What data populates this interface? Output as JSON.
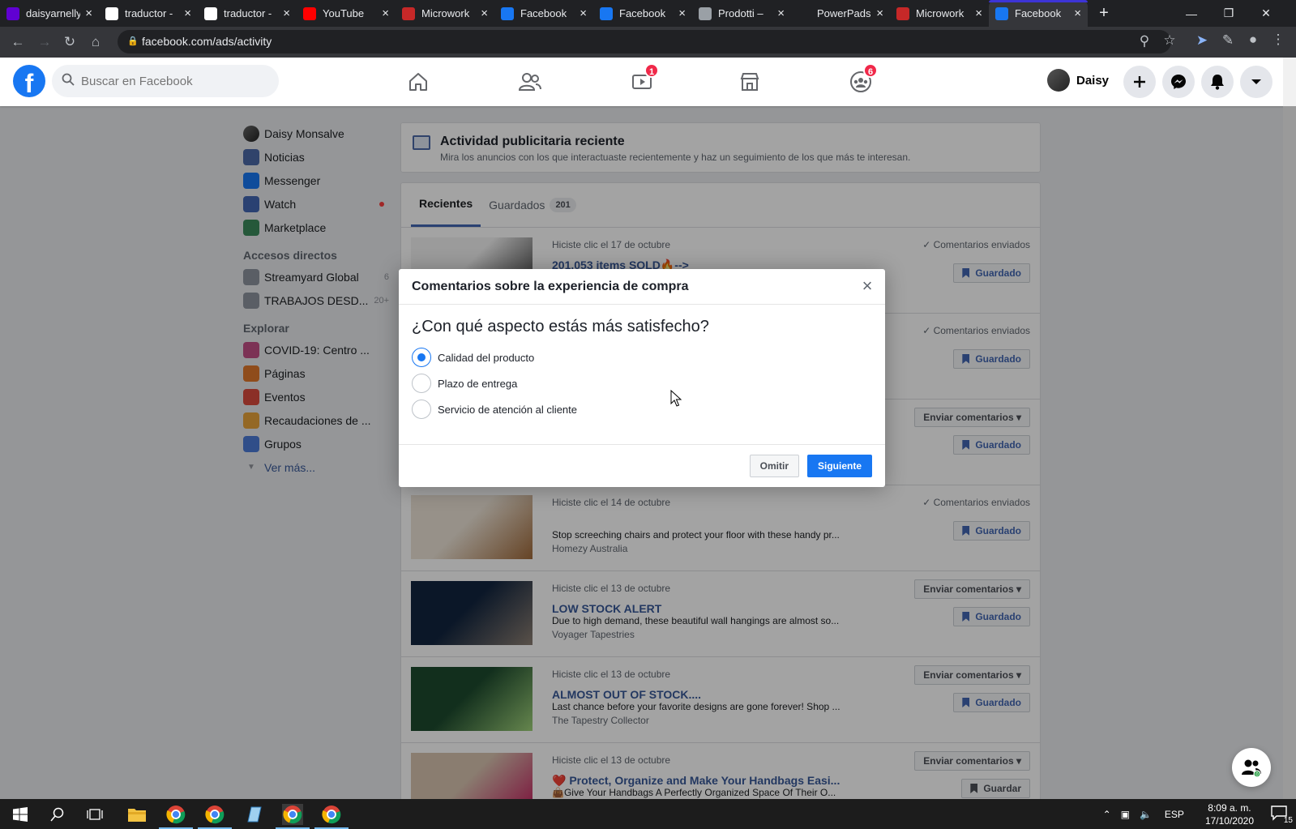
{
  "browser": {
    "tabs": [
      {
        "title": "daisyarnelly",
        "favicon": "mail-icon",
        "color": "#6001d2"
      },
      {
        "title": "traductor -",
        "favicon": "google-icon",
        "color": "#ffffff"
      },
      {
        "title": "traductor -",
        "favicon": "google-icon",
        "color": "#ffffff"
      },
      {
        "title": "YouTube",
        "favicon": "youtube-icon",
        "color": "#ff0000"
      },
      {
        "title": "Microwork",
        "favicon": "microworkers-icon",
        "color": "#c62828"
      },
      {
        "title": "Facebook",
        "favicon": "facebook-icon",
        "color": "#1877f2"
      },
      {
        "title": "Facebook",
        "favicon": "facebook-icon",
        "color": "#1877f2"
      },
      {
        "title": "Prodotti –",
        "favicon": "globe-icon",
        "color": "#9aa0a6"
      },
      {
        "title": "PowerPads",
        "favicon": "blank-icon",
        "color": "#202124"
      },
      {
        "title": "Microwork",
        "favicon": "microworkers-icon",
        "color": "#c62828"
      },
      {
        "title": "Facebook",
        "favicon": "facebook-icon",
        "color": "#1877f2",
        "active": true
      }
    ],
    "url": "facebook.com/ads/activity"
  },
  "header": {
    "logo": "f",
    "search_placeholder": "Buscar en Facebook",
    "watch_badge": "1",
    "groups_badge": "6",
    "user_name": "Daisy"
  },
  "sidebar": {
    "user": "Daisy Monsalve",
    "items": [
      {
        "label": "Noticias",
        "color": "#4b6aa8"
      },
      {
        "label": "Messenger",
        "color": "#1877f2"
      },
      {
        "label": "Watch",
        "color": "#4267b2"
      },
      {
        "label": "Marketplace",
        "color": "#3a8a5c"
      }
    ],
    "shortcuts_heading": "Accesos directos",
    "shortcuts": [
      {
        "label": "Streamyard Global",
        "count": "6"
      },
      {
        "label": "TRABAJOS DESD...",
        "count": "20+"
      }
    ],
    "explore_heading": "Explorar",
    "explore": [
      {
        "label": "COVID-19: Centro ...",
        "color": "#c34f86"
      },
      {
        "label": "Páginas",
        "color": "#e0782b"
      },
      {
        "label": "Eventos",
        "color": "#d94a3d"
      },
      {
        "label": "Recaudaciones de ...",
        "color": "#e8a33b"
      },
      {
        "label": "Grupos",
        "color": "#4b7bd6"
      }
    ],
    "more": "Ver más..."
  },
  "activity": {
    "title": "Actividad publicitaria reciente",
    "subtitle": "Mira los anuncios con los que interactuaste recientemente y haz un seguimiento de los que más te interesan.",
    "tab_recent": "Recientes",
    "tab_saved": "Guardados",
    "saved_count": "201",
    "ads": [
      {
        "date": "Hiciste clic el 17 de octubre",
        "title": "201.053 items SOLD🔥-->",
        "desc": "",
        "advertiser": "",
        "status": "✓ Comentarios enviados",
        "feedback": "",
        "save": "Guardado",
        "thumb_a": "#f2f2f2",
        "thumb_b": "#2a2a2a"
      },
      {
        "date": "",
        "title": "",
        "desc": "",
        "advertiser": "",
        "status": "✓ Comentarios enviados",
        "feedback": "",
        "save": "Guardado",
        "thumb_a": "#ffffff",
        "thumb_b": "#ffffff"
      },
      {
        "date": "",
        "title": "",
        "desc": "",
        "advertiser": "",
        "status": "",
        "feedback": "Enviar comentarios ▾",
        "save": "Guardado",
        "thumb_a": "#ffffff",
        "thumb_b": "#ffffff"
      },
      {
        "date": "Hiciste clic el 14 de octubre",
        "title": "",
        "desc": "Stop screeching chairs and protect your floor with these handy pr...",
        "advertiser": "Homezy Australia",
        "status": "✓ Comentarios enviados",
        "feedback": "",
        "save": "Guardado",
        "thumb_a": "#ece3d6",
        "thumb_b": "#a06a3a"
      },
      {
        "date": "Hiciste clic el 13 de octubre",
        "title": "LOW STOCK ALERT",
        "desc": "Due to high demand, these beautiful wall hangings are almost so...",
        "advertiser": "Voyager Tapestries",
        "status": "",
        "feedback": "Enviar comentarios ▾",
        "save": "Guardado",
        "thumb_a": "#12253f",
        "thumb_b": "#8c7f73"
      },
      {
        "date": "Hiciste clic el 13 de octubre",
        "title": "ALMOST OUT OF STOCK....",
        "desc": "Last chance before your favorite designs are gone forever! Shop ...",
        "advertiser": "The Tapestry Collector",
        "status": "",
        "feedback": "Enviar comentarios ▾",
        "save": "Guardado",
        "thumb_a": "#1d4a2e",
        "thumb_b": "#9fd27a"
      },
      {
        "date": "Hiciste clic el 13 de octubre",
        "title": "❤️ Protect, Organize and Make Your Handbags Easi...",
        "desc": "👜Give Your Handbags A Perfectly Organized Space Of Their O...",
        "advertiser": "",
        "status": "",
        "feedback": "Enviar comentarios ▾",
        "save": "Guardar",
        "thumb_a": "#d8c4b0",
        "thumb_b": "#c2185b"
      }
    ]
  },
  "modal": {
    "title": "Comentarios sobre la experiencia de compra",
    "question": "¿Con qué aspecto estás más satisfecho?",
    "options": [
      {
        "label": "Calidad del producto",
        "selected": true
      },
      {
        "label": "Plazo de entrega",
        "selected": false
      },
      {
        "label": "Servicio de atención al cliente",
        "selected": false
      }
    ],
    "skip": "Omitir",
    "next": "Siguiente"
  },
  "chat_count": "0",
  "taskbar": {
    "lang": "ESP",
    "time": "8:09 a. m.",
    "date": "17/10/2020",
    "notifications": "15"
  }
}
